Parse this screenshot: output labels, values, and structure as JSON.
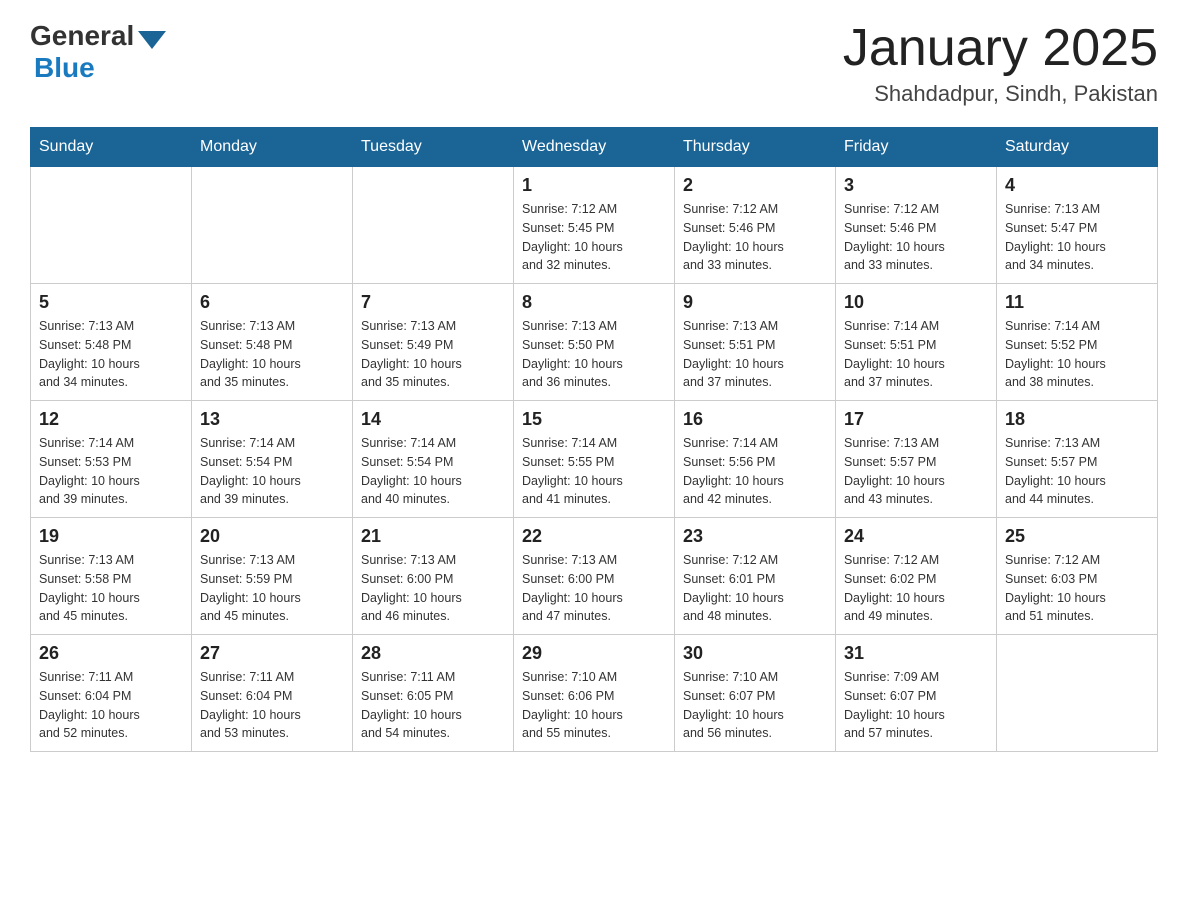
{
  "header": {
    "logo_general": "General",
    "logo_blue": "Blue",
    "title": "January 2025",
    "location": "Shahdadpur, Sindh, Pakistan"
  },
  "days_of_week": [
    "Sunday",
    "Monday",
    "Tuesday",
    "Wednesday",
    "Thursday",
    "Friday",
    "Saturday"
  ],
  "weeks": [
    [
      {
        "day": "",
        "info": ""
      },
      {
        "day": "",
        "info": ""
      },
      {
        "day": "",
        "info": ""
      },
      {
        "day": "1",
        "info": "Sunrise: 7:12 AM\nSunset: 5:45 PM\nDaylight: 10 hours\nand 32 minutes."
      },
      {
        "day": "2",
        "info": "Sunrise: 7:12 AM\nSunset: 5:46 PM\nDaylight: 10 hours\nand 33 minutes."
      },
      {
        "day": "3",
        "info": "Sunrise: 7:12 AM\nSunset: 5:46 PM\nDaylight: 10 hours\nand 33 minutes."
      },
      {
        "day": "4",
        "info": "Sunrise: 7:13 AM\nSunset: 5:47 PM\nDaylight: 10 hours\nand 34 minutes."
      }
    ],
    [
      {
        "day": "5",
        "info": "Sunrise: 7:13 AM\nSunset: 5:48 PM\nDaylight: 10 hours\nand 34 minutes."
      },
      {
        "day": "6",
        "info": "Sunrise: 7:13 AM\nSunset: 5:48 PM\nDaylight: 10 hours\nand 35 minutes."
      },
      {
        "day": "7",
        "info": "Sunrise: 7:13 AM\nSunset: 5:49 PM\nDaylight: 10 hours\nand 35 minutes."
      },
      {
        "day": "8",
        "info": "Sunrise: 7:13 AM\nSunset: 5:50 PM\nDaylight: 10 hours\nand 36 minutes."
      },
      {
        "day": "9",
        "info": "Sunrise: 7:13 AM\nSunset: 5:51 PM\nDaylight: 10 hours\nand 37 minutes."
      },
      {
        "day": "10",
        "info": "Sunrise: 7:14 AM\nSunset: 5:51 PM\nDaylight: 10 hours\nand 37 minutes."
      },
      {
        "day": "11",
        "info": "Sunrise: 7:14 AM\nSunset: 5:52 PM\nDaylight: 10 hours\nand 38 minutes."
      }
    ],
    [
      {
        "day": "12",
        "info": "Sunrise: 7:14 AM\nSunset: 5:53 PM\nDaylight: 10 hours\nand 39 minutes."
      },
      {
        "day": "13",
        "info": "Sunrise: 7:14 AM\nSunset: 5:54 PM\nDaylight: 10 hours\nand 39 minutes."
      },
      {
        "day": "14",
        "info": "Sunrise: 7:14 AM\nSunset: 5:54 PM\nDaylight: 10 hours\nand 40 minutes."
      },
      {
        "day": "15",
        "info": "Sunrise: 7:14 AM\nSunset: 5:55 PM\nDaylight: 10 hours\nand 41 minutes."
      },
      {
        "day": "16",
        "info": "Sunrise: 7:14 AM\nSunset: 5:56 PM\nDaylight: 10 hours\nand 42 minutes."
      },
      {
        "day": "17",
        "info": "Sunrise: 7:13 AM\nSunset: 5:57 PM\nDaylight: 10 hours\nand 43 minutes."
      },
      {
        "day": "18",
        "info": "Sunrise: 7:13 AM\nSunset: 5:57 PM\nDaylight: 10 hours\nand 44 minutes."
      }
    ],
    [
      {
        "day": "19",
        "info": "Sunrise: 7:13 AM\nSunset: 5:58 PM\nDaylight: 10 hours\nand 45 minutes."
      },
      {
        "day": "20",
        "info": "Sunrise: 7:13 AM\nSunset: 5:59 PM\nDaylight: 10 hours\nand 45 minutes."
      },
      {
        "day": "21",
        "info": "Sunrise: 7:13 AM\nSunset: 6:00 PM\nDaylight: 10 hours\nand 46 minutes."
      },
      {
        "day": "22",
        "info": "Sunrise: 7:13 AM\nSunset: 6:00 PM\nDaylight: 10 hours\nand 47 minutes."
      },
      {
        "day": "23",
        "info": "Sunrise: 7:12 AM\nSunset: 6:01 PM\nDaylight: 10 hours\nand 48 minutes."
      },
      {
        "day": "24",
        "info": "Sunrise: 7:12 AM\nSunset: 6:02 PM\nDaylight: 10 hours\nand 49 minutes."
      },
      {
        "day": "25",
        "info": "Sunrise: 7:12 AM\nSunset: 6:03 PM\nDaylight: 10 hours\nand 51 minutes."
      }
    ],
    [
      {
        "day": "26",
        "info": "Sunrise: 7:11 AM\nSunset: 6:04 PM\nDaylight: 10 hours\nand 52 minutes."
      },
      {
        "day": "27",
        "info": "Sunrise: 7:11 AM\nSunset: 6:04 PM\nDaylight: 10 hours\nand 53 minutes."
      },
      {
        "day": "28",
        "info": "Sunrise: 7:11 AM\nSunset: 6:05 PM\nDaylight: 10 hours\nand 54 minutes."
      },
      {
        "day": "29",
        "info": "Sunrise: 7:10 AM\nSunset: 6:06 PM\nDaylight: 10 hours\nand 55 minutes."
      },
      {
        "day": "30",
        "info": "Sunrise: 7:10 AM\nSunset: 6:07 PM\nDaylight: 10 hours\nand 56 minutes."
      },
      {
        "day": "31",
        "info": "Sunrise: 7:09 AM\nSunset: 6:07 PM\nDaylight: 10 hours\nand 57 minutes."
      },
      {
        "day": "",
        "info": ""
      }
    ]
  ]
}
